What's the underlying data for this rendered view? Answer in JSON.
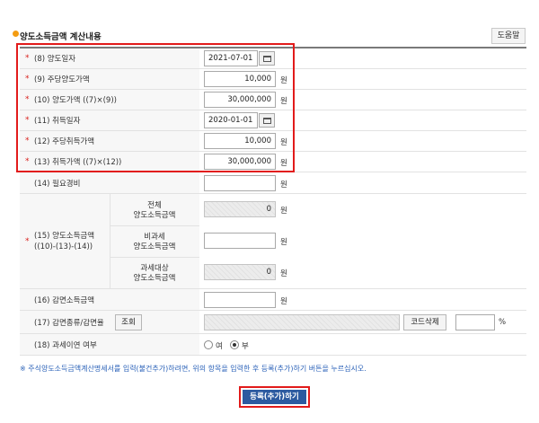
{
  "header": {
    "section_title": "양도소득금액 계산내용",
    "help_label": "도움말"
  },
  "fields": {
    "f8": {
      "label": "(8) 양도일자",
      "value": "2021-07-01"
    },
    "f9": {
      "label": "(9) 주당양도가액",
      "value": "10,000",
      "unit": "원"
    },
    "f10": {
      "label": "(10) 양도가액 ((7)×(9))",
      "value": "30,000,000",
      "unit": "원"
    },
    "f11": {
      "label": "(11) 취득일자",
      "value": "2020-01-01"
    },
    "f12": {
      "label": "(12) 주당취득가액",
      "value": "10,000",
      "unit": "원"
    },
    "f13": {
      "label": "(13) 취득가액 ((7)×(12))",
      "value": "30,000,000",
      "unit": "원"
    },
    "f14": {
      "label": "(14) 필요경비",
      "value": "",
      "unit": "원"
    },
    "f15": {
      "label_line1": "(15) 양도소득금액",
      "label_line2": "((10)-(13)-(14))",
      "total_line1": "전체",
      "total_line2": "양도소득금액",
      "total_value": "0",
      "nontax_line1": "비과세",
      "nontax_line2": "양도소득금액",
      "nontax_value": "",
      "taxable_line1": "과세대상",
      "taxable_line2": "양도소득금액",
      "taxable_value": "0",
      "unit": "원"
    },
    "f16": {
      "label": "(16) 감면소득금액",
      "value": "",
      "unit": "원"
    },
    "f17": {
      "label": "(17) 감면종류/감면율",
      "lookup_label": "조회",
      "code_delete_label": "코드삭제",
      "rate_value": "",
      "unit": "%"
    },
    "f18": {
      "label": "(18) 과세이연 여부",
      "option_yes": "여",
      "option_no": "부",
      "selected": "부"
    }
  },
  "footer": {
    "note": "※ 주식양도소득금액계산명세서를 입력(불건추가)하려면, 위의 항목을 입력한 후 등록(추가)하기 버튼을 누르십시오.",
    "submit_label": "등록(추가)하기"
  },
  "colors": {
    "required_star": "#d9211d",
    "highlight_border": "#e21b1b",
    "submit_bg": "#2c5aa0",
    "note_text": "#2b62b8"
  }
}
